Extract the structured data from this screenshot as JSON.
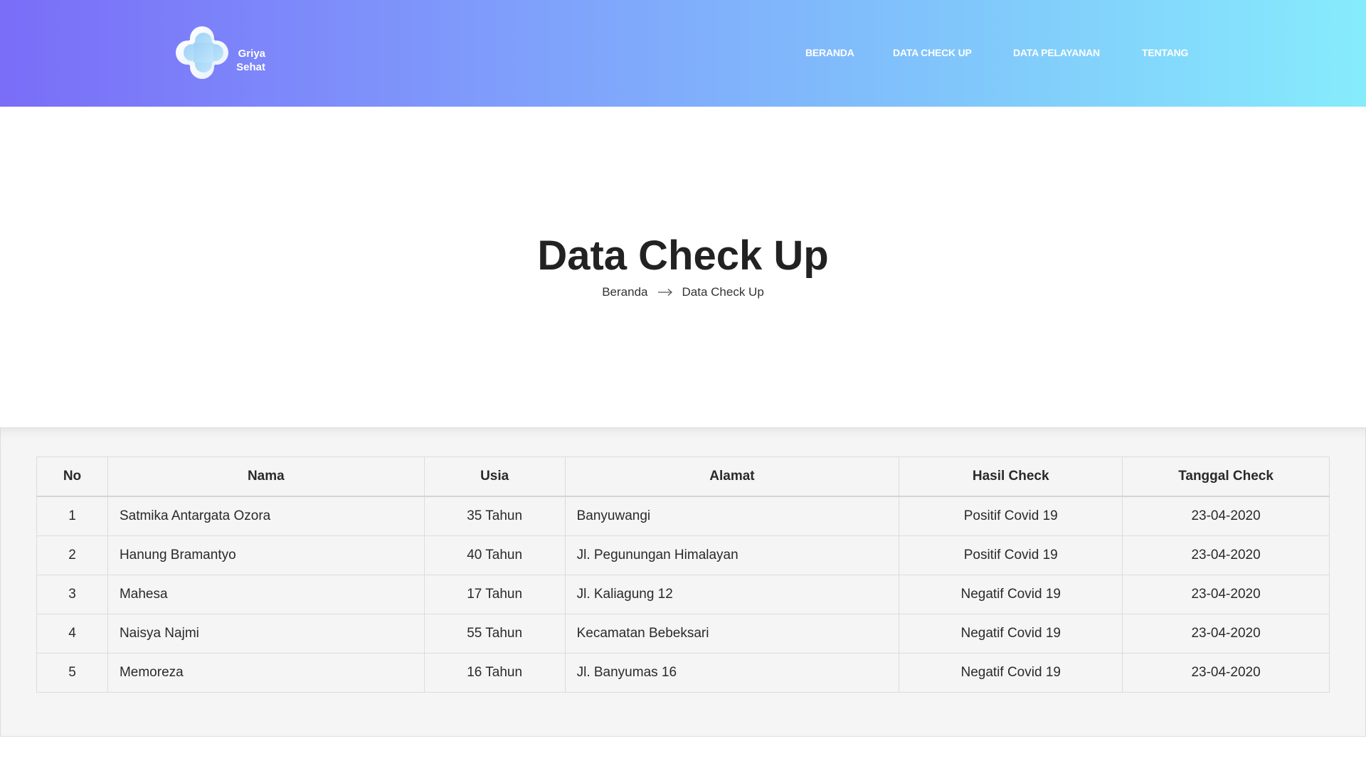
{
  "header": {
    "logo": {
      "line1": "Griya",
      "line2": "Sehat"
    },
    "nav": [
      {
        "label": "BERANDA"
      },
      {
        "label": "DATA CHECK UP"
      },
      {
        "label": "DATA PELAYANAN"
      },
      {
        "label": "TENTANG"
      }
    ]
  },
  "page": {
    "title": "Data Check Up",
    "breadcrumb": {
      "home": "Beranda",
      "current": "Data Check Up"
    }
  },
  "table": {
    "columns": [
      "No",
      "Nama",
      "Usia",
      "Alamat",
      "Hasil Check",
      "Tanggal Check"
    ],
    "rows": [
      {
        "no": "1",
        "nama": "Satmika Antargata Ozora",
        "usia": "35 Tahun",
        "alamat": "Banyuwangi",
        "hasil": "Positif Covid 19",
        "tanggal": "23-04-2020"
      },
      {
        "no": "2",
        "nama": "Hanung Bramantyo",
        "usia": "40 Tahun",
        "alamat": "Jl. Pegunungan Himalayan",
        "hasil": "Positif Covid 19",
        "tanggal": "23-04-2020"
      },
      {
        "no": "3",
        "nama": "Mahesa",
        "usia": "17 Tahun",
        "alamat": "Jl. Kaliagung 12",
        "hasil": "Negatif Covid 19",
        "tanggal": "23-04-2020"
      },
      {
        "no": "4",
        "nama": "Naisya Najmi",
        "usia": "55 Tahun",
        "alamat": "Kecamatan Bebeksari",
        "hasil": "Negatif Covid 19",
        "tanggal": "23-04-2020"
      },
      {
        "no": "5",
        "nama": "Memoreza",
        "usia": "16 Tahun",
        "alamat": "Jl. Banyumas 16",
        "hasil": "Negatif Covid 19",
        "tanggal": "23-04-2020"
      }
    ]
  }
}
